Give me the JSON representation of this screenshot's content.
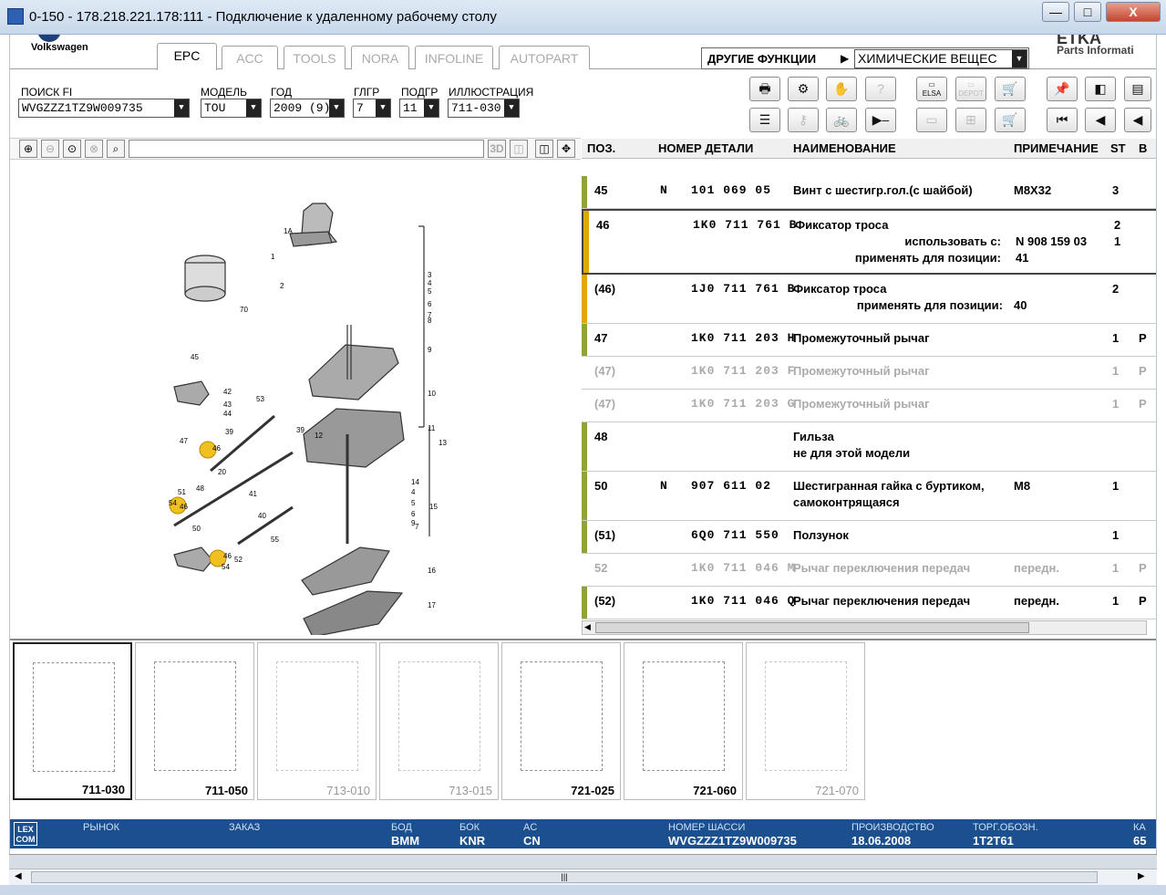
{
  "window": {
    "title": "0-150 - 178.218.221.178:111 - Подключение к удаленному рабочему столу",
    "min": "—",
    "max": "□",
    "close": "X"
  },
  "brand": {
    "name": "Volkswagen",
    "right_logo": "ETKA",
    "right_sub": "Parts Informati"
  },
  "tabs": [
    "EPC",
    "ACC",
    "TOOLS",
    "NORA",
    "INFOLINE",
    "AUTOPART"
  ],
  "other_functions": {
    "label": "ДРУГИЕ ФУНКЦИИ",
    "value": "ХИМИЧЕСКИЕ ВЕЩЕС"
  },
  "filters": [
    {
      "label": "ПОИСК FI",
      "value": "WVGZZZ1TZ9W009735"
    },
    {
      "label": "МОДЕЛЬ",
      "value": "TOU"
    },
    {
      "label": "ГОД",
      "value": "2009 (9)"
    },
    {
      "label": "ГЛГР",
      "value": "7"
    },
    {
      "label": "ПОДГР",
      "value": "11"
    },
    {
      "label": "ИЛЛЮСТРАЦИЯ",
      "value": "711-030"
    }
  ],
  "toolbar_icons": [
    "print-icon",
    "parts-icon",
    "handshake-icon",
    "help-icon",
    "elsa-icon",
    "depot-icon",
    "cart-arrow-icon",
    "pin-icon",
    "doc-back-icon",
    "doc-icon",
    "list-icon",
    "key-icon",
    "bicycle-icon",
    "play-icon",
    "pc-icon",
    "tree-icon",
    "cart-icon",
    "first-icon",
    "prev-icon",
    "next-icon"
  ],
  "toolbar_text": {
    "elsa": "ELSA",
    "depot": "DEPOT"
  },
  "zoom": {
    "view3d": "3D"
  },
  "table": {
    "columns": [
      "ПОЗ.",
      "НОМЕР ДЕТАЛИ",
      "НАИМЕНОВАНИЕ",
      "ПРИМЕЧАНИЕ",
      "ST",
      "В"
    ],
    "rows": [
      {
        "pos": "45",
        "prefix": "N",
        "part": "101 069 05",
        "name": "Винт с шестигр.гол.(с шайбой)",
        "note": "M8X32",
        "st": "3",
        "b": "",
        "color": "#8fa33a",
        "grey": false
      },
      {
        "pos": "46",
        "prefix": "",
        "part": "1K0 711 761 B",
        "name": "Фиксатор троса",
        "note": "",
        "st": "2",
        "b": "",
        "color": "#e0a800",
        "grey": false,
        "sub": [
          {
            "label": "использовать с:",
            "val": "N  908 159 03",
            "st": "1"
          },
          {
            "label": "применять для позиции:",
            "val": "41",
            "st": ""
          }
        ]
      },
      {
        "pos": "(46)",
        "prefix": "",
        "part": "1J0 711 761 B",
        "name": "Фиксатор троса",
        "note": "",
        "st": "2",
        "b": "",
        "color": "#e0a800",
        "grey": false,
        "sub": [
          {
            "label": "применять для позиции:",
            "val": "40",
            "st": ""
          }
        ]
      },
      {
        "pos": "47",
        "prefix": "",
        "part": "1K0 711 203 H",
        "name": "Промежуточный рычаг",
        "note": "",
        "st": "1",
        "b": "P",
        "color": "#8fa33a",
        "grey": false
      },
      {
        "pos": "(47)",
        "prefix": "",
        "part": "1K0 711 203 F",
        "name": "Промежуточный рычаг",
        "note": "",
        "st": "1",
        "b": "P",
        "color": "",
        "grey": true
      },
      {
        "pos": "(47)",
        "prefix": "",
        "part": "1K0 711 203 G",
        "name": "Промежуточный рычаг",
        "note": "",
        "st": "1",
        "b": "P",
        "color": "",
        "grey": true
      },
      {
        "pos": "48",
        "prefix": "",
        "part": "",
        "name": "Гильза",
        "name2": "не для этой модели",
        "note": "",
        "st": "",
        "b": "",
        "color": "#8fa33a",
        "grey": false
      },
      {
        "pos": "50",
        "prefix": "N",
        "part": "907 611 02",
        "name": "Шестигранная гайка с буртиком,",
        "name2": "самоконтрящаяся",
        "note": "M8",
        "st": "1",
        "b": "",
        "color": "#8fa33a",
        "grey": false
      },
      {
        "pos": "(51)",
        "prefix": "",
        "part": "6Q0 711 550",
        "name": "Ползунок",
        "note": "",
        "st": "1",
        "b": "",
        "color": "#8fa33a",
        "grey": false
      },
      {
        "pos": "52",
        "prefix": "",
        "part": "1K0 711 046 M",
        "name": "Рычаг переключения передач",
        "note": "передн.",
        "st": "1",
        "b": "P",
        "color": "",
        "grey": true
      },
      {
        "pos": "(52)",
        "prefix": "",
        "part": "1K0 711 046 Q",
        "name": "Рычаг переключения передач",
        "note": "передн.",
        "st": "1",
        "b": "P",
        "color": "#8fa33a",
        "grey": false
      }
    ]
  },
  "diagram_labels": [
    "1A",
    "1",
    "2",
    "70",
    "45",
    "42",
    "43",
    "44",
    "53",
    "39",
    "39",
    "12",
    "47",
    "46",
    "20",
    "48",
    "51",
    "54",
    "46",
    "41",
    "40",
    "50",
    "55",
    "46",
    "52",
    "54",
    "3",
    "4",
    "5",
    "6",
    "7",
    "8",
    "9",
    "10",
    "11",
    "13",
    "14",
    "4",
    "5",
    "6",
    "7",
    "15",
    "9",
    "16",
    "17"
  ],
  "thumbnails": [
    {
      "caption": "711-030",
      "active": true
    },
    {
      "caption": "711-050",
      "active": true
    },
    {
      "caption": "713-010",
      "active": false
    },
    {
      "caption": "713-015",
      "active": false
    },
    {
      "caption": "721-025",
      "active": true
    },
    {
      "caption": "721-060",
      "active": true
    },
    {
      "caption": "721-070",
      "active": false
    }
  ],
  "status": {
    "logo": "LEX COM",
    "fields": [
      {
        "k": "РЫНОК",
        "v": ""
      },
      {
        "k": "ЗАКАЗ",
        "v": ""
      },
      {
        "k": "БОД",
        "v": "BMM"
      },
      {
        "k": "БОК",
        "v": "KNR"
      },
      {
        "k": "AC",
        "v": "CN"
      },
      {
        "k": "НОМЕР ШАССИ",
        "v": "WVGZZZ1TZ9W009735"
      },
      {
        "k": "ПРОИЗВОДСТВО",
        "v": "18.06.2008"
      },
      {
        "k": "ТОРГ.ОБОЗН.",
        "v": "1T2T61"
      },
      {
        "k": "КА",
        "v": "65"
      }
    ]
  }
}
